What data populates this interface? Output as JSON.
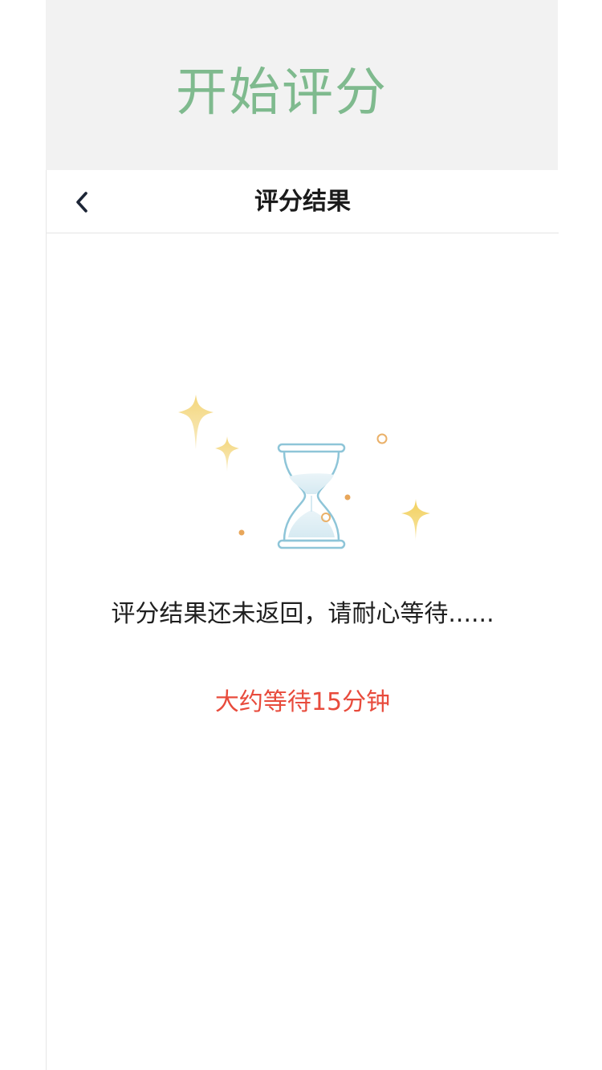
{
  "banner": {
    "title": "开始评分"
  },
  "nav": {
    "back_icon": "chevron-left-icon",
    "title": "评分结果"
  },
  "illustration": {
    "icon": "hourglass-icon",
    "decorations": [
      "sparkle-icon",
      "circle-dot-icon"
    ]
  },
  "status": {
    "message": "评分结果还未返回，请耐心等待......",
    "eta": "大约等待15分钟"
  },
  "colors": {
    "banner_text": "#7fba8e",
    "eta_text": "#e84b3c",
    "hourglass": "#8ec5d8",
    "sparkle": "#f2cf5b",
    "dot": "#e8a65a"
  }
}
